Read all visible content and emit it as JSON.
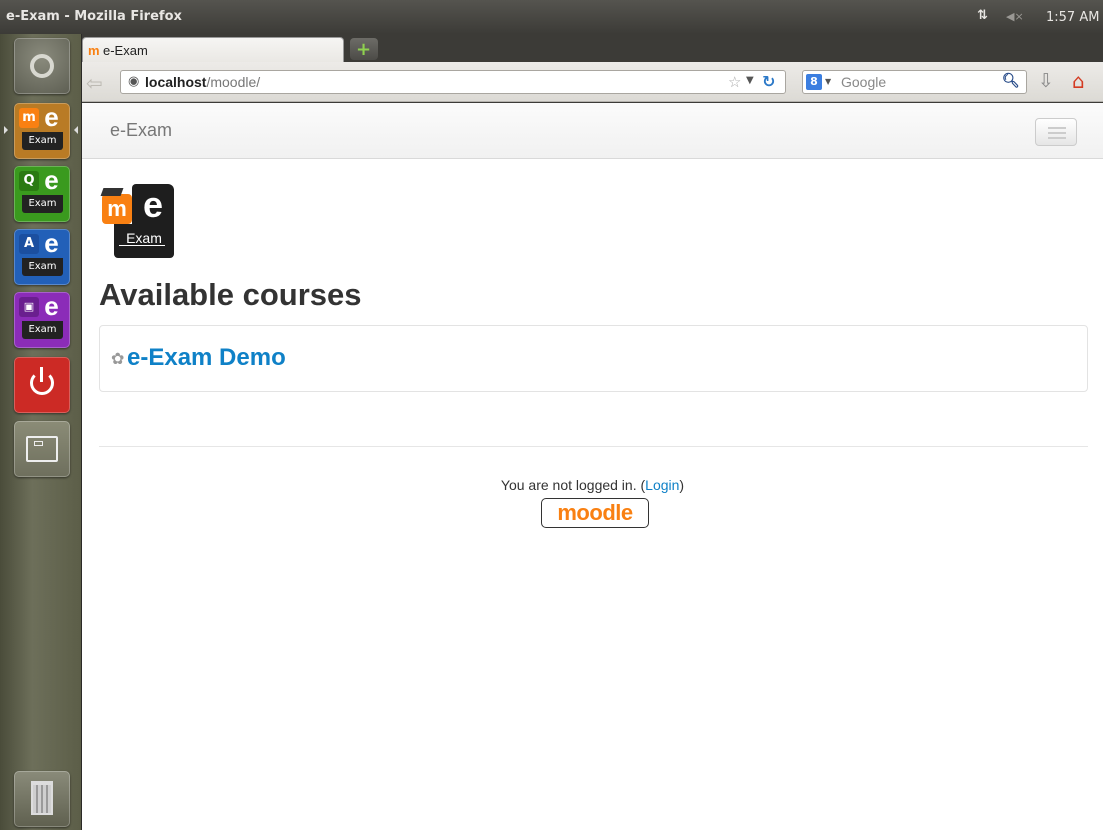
{
  "system": {
    "window_title": "e-Exam - Mozilla Firefox",
    "network_icon": "⇅",
    "volume_icon": "◀×",
    "clock": "1:57 AM"
  },
  "launcher": {
    "items": [
      {
        "name": "dash",
        "icon": "ubuntu-logo-icon"
      },
      {
        "name": "moodle-exam",
        "badge": "m",
        "letter": "e",
        "label": "Exam",
        "color": "#b97b25"
      },
      {
        "name": "quiz-exam",
        "badge": "Q",
        "letter": "e",
        "label": "Exam",
        "color": "#3a9a1e"
      },
      {
        "name": "answer-exam",
        "badge": "A",
        "letter": "e",
        "label": "Exam",
        "color": "#2260b8"
      },
      {
        "name": "video-exam",
        "badge": "▣",
        "letter": "e",
        "label": "Exam",
        "color": "#8b2cb8"
      },
      {
        "name": "shutdown",
        "icon": "power-icon",
        "color": "#cc2a25"
      },
      {
        "name": "workspace-switcher",
        "icon": "workspace-icon"
      },
      {
        "name": "trash",
        "icon": "trash-icon"
      }
    ]
  },
  "browser": {
    "tab": {
      "favicon": "m",
      "label": "e-Exam"
    },
    "new_tab": "+",
    "url": {
      "host": "localhost",
      "path": "/moodle/"
    },
    "search": {
      "engine": "8",
      "placeholder": "Google"
    }
  },
  "page": {
    "brand": "e-Exam",
    "logo": {
      "m": "m",
      "e": "e",
      "exam": "Exam"
    },
    "heading": "Available courses",
    "courses": [
      {
        "name": "e-Exam Demo"
      }
    ],
    "footer": {
      "not_logged": "You are not logged in. (",
      "login_link": "Login",
      "close_paren": ")",
      "moodle_logo": "moodle"
    }
  },
  "colors": {
    "accent_link": "#0f81c7",
    "moodle_orange": "#f98012"
  }
}
